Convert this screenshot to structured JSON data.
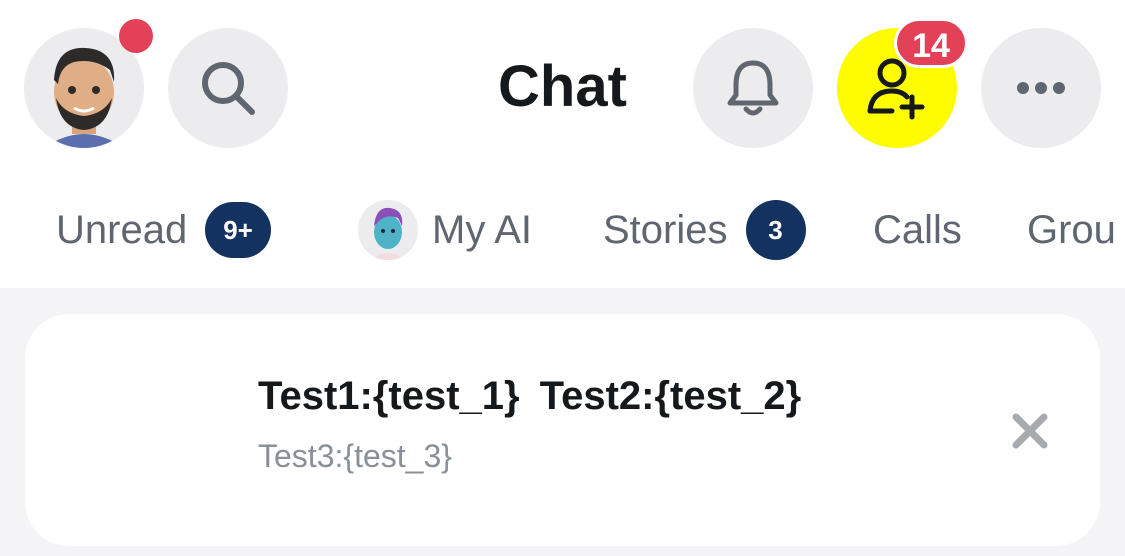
{
  "header": {
    "title": "Chat",
    "friend_requests_count": "14"
  },
  "tabs": [
    {
      "label": "Unread",
      "badge": "9+"
    },
    {
      "label": "My AI"
    },
    {
      "label": "Stories",
      "badge": "3"
    },
    {
      "label": "Calls"
    },
    {
      "label": "Grou"
    }
  ],
  "card": {
    "line1_a": "Test1:{test_1}",
    "line1_b": "Test2:{test_2}",
    "line2": "Test3:{test_3}"
  },
  "colors": {
    "accent_yellow": "#fffc00",
    "notification_red": "#e34157",
    "badge_navy": "#14325f"
  },
  "icons": [
    "avatar",
    "search-icon",
    "bell-icon",
    "add-friend-icon",
    "more-icon",
    "close-icon"
  ]
}
